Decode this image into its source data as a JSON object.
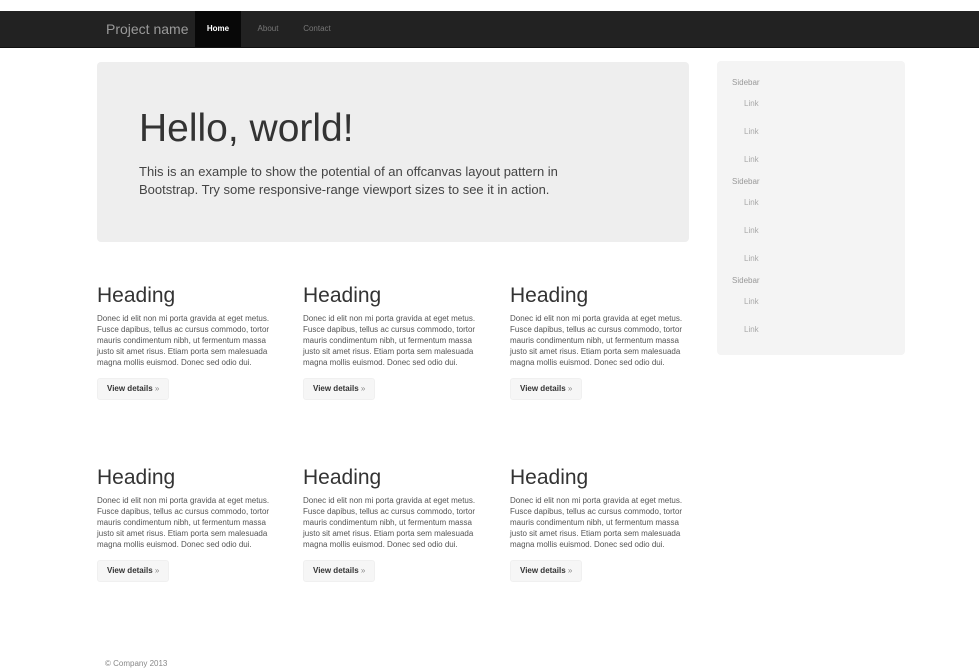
{
  "navbar": {
    "brand": "Project name",
    "items": [
      {
        "label": "Home",
        "active": true
      },
      {
        "label": "About",
        "active": false
      },
      {
        "label": "Contact",
        "active": false
      }
    ]
  },
  "jumbotron": {
    "title": "Hello, world!",
    "text": "This is an example to show the potential of an offcanvas layout pattern in Bootstrap. Try some responsive-range viewport sizes to see it in action."
  },
  "cards": [
    {
      "heading": "Heading",
      "text": "Donec id elit non mi porta gravida at eget metus. Fusce dapibus, tellus ac cursus commodo, tortor mauris condimentum nibh, ut fermentum massa justo sit amet risus. Etiam porta sem malesuada magna mollis euismod. Donec sed odio dui.",
      "button": "View details",
      "button_arrow": "»"
    },
    {
      "heading": "Heading",
      "text": "Donec id elit non mi porta gravida at eget metus. Fusce dapibus, tellus ac cursus commodo, tortor mauris condimentum nibh, ut fermentum massa justo sit amet risus. Etiam porta sem malesuada magna mollis euismod. Donec sed odio dui.",
      "button": "View details",
      "button_arrow": "»"
    },
    {
      "heading": "Heading",
      "text": "Donec id elit non mi porta gravida at eget metus. Fusce dapibus, tellus ac cursus commodo, tortor mauris condimentum nibh, ut fermentum massa justo sit amet risus. Etiam porta sem malesuada magna mollis euismod. Donec sed odio dui.",
      "button": "View details",
      "button_arrow": "»"
    },
    {
      "heading": "Heading",
      "text": "Donec id elit non mi porta gravida at eget metus. Fusce dapibus, tellus ac cursus commodo, tortor mauris condimentum nibh, ut fermentum massa justo sit amet risus. Etiam porta sem malesuada magna mollis euismod. Donec sed odio dui.",
      "button": "View details",
      "button_arrow": "»"
    },
    {
      "heading": "Heading",
      "text": "Donec id elit non mi porta gravida at eget metus. Fusce dapibus, tellus ac cursus commodo, tortor mauris condimentum nibh, ut fermentum massa justo sit amet risus. Etiam porta sem malesuada magna mollis euismod. Donec sed odio dui.",
      "button": "View details",
      "button_arrow": "»"
    },
    {
      "heading": "Heading",
      "text": "Donec id elit non mi porta gravida at eget metus. Fusce dapibus, tellus ac cursus commodo, tortor mauris condimentum nibh, ut fermentum massa justo sit amet risus. Etiam porta sem malesuada magna mollis euismod. Donec sed odio dui.",
      "button": "View details",
      "button_arrow": "»"
    }
  ],
  "sidebar": {
    "entries": [
      {
        "type": "header",
        "label": "Sidebar"
      },
      {
        "type": "link",
        "label": "Link"
      },
      {
        "type": "link",
        "label": "Link"
      },
      {
        "type": "link",
        "label": "Link"
      },
      {
        "type": "header",
        "label": "Sidebar"
      },
      {
        "type": "link",
        "label": "Link"
      },
      {
        "type": "link",
        "label": "Link"
      },
      {
        "type": "link",
        "label": "Link"
      },
      {
        "type": "header",
        "label": "Sidebar"
      },
      {
        "type": "link",
        "label": "Link"
      },
      {
        "type": "link",
        "label": "Link"
      }
    ]
  },
  "footer": {
    "text": "© Company 2013"
  },
  "colors": {
    "navbar_bg": "#222222",
    "active_nav_bg": "#080808",
    "jumbotron_bg": "#eeeeee",
    "sidebar_bg": "#f4f4f4"
  }
}
